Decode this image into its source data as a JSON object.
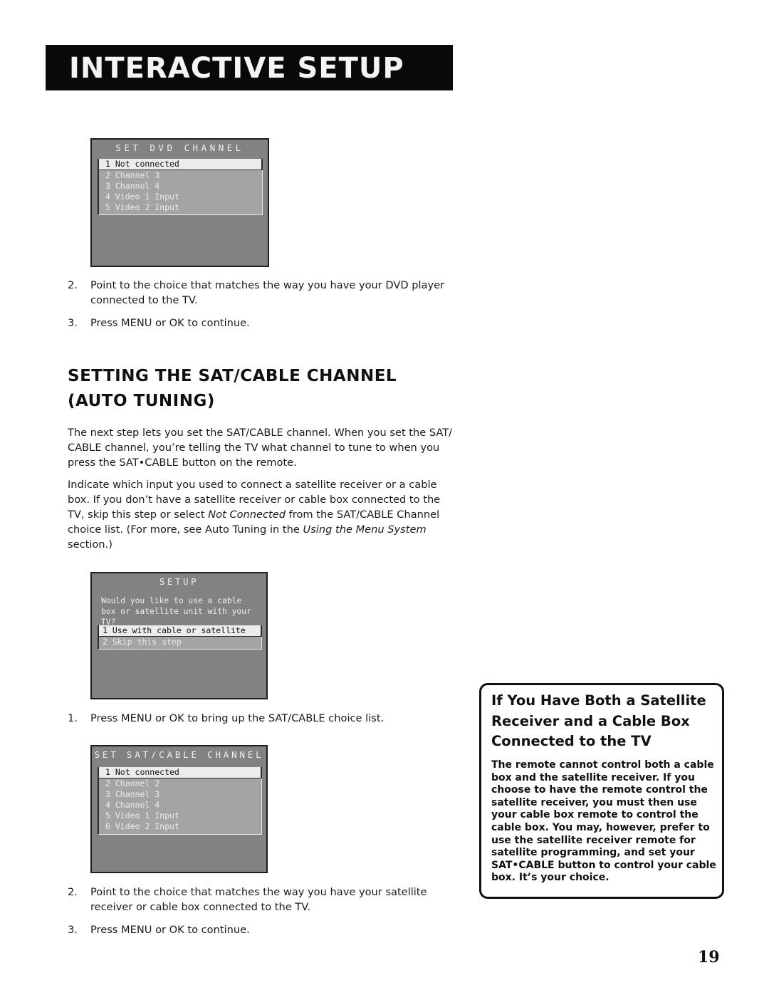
{
  "header": {
    "title": "Interactive Setup"
  },
  "dvd_menu": {
    "title": "SET DVD CHANNEL",
    "items": [
      "1 Not connected",
      "2 Channel 3",
      "3 Channel 4",
      "4 Video 1 Input",
      "5 Video 2 Input"
    ],
    "selected_index": 0
  },
  "dvd_steps": [
    {
      "num": "2.",
      "text": "Point to the choice that matches the way you have your DVD player connected to the TV."
    },
    {
      "num": "3.",
      "text": "Press MENU or OK to continue."
    }
  ],
  "section": {
    "title_line1": "Setting the SAT/CABLE Channel",
    "title_line2": "(Auto Tuning)",
    "para1": "The next step lets you set the SAT/CABLE channel. When you set the SAT/ CABLE channel, you’re telling the TV what channel to tune to when you press the SAT•CABLE button on the remote.",
    "para2_a": "Indicate which input you used to connect a satellite receiver or a cable box. If you don’t have a satellite receiver or cable box connected to the TV, skip this step or select ",
    "para2_b": "Not Connected",
    "para2_c": " from the SAT/CABLE Channel choice list. (For more, see Auto Tuning in the ",
    "para2_d": "Using the Menu System",
    "para2_e": " section.)"
  },
  "setup_menu": {
    "title": "SETUP",
    "prompt": "Would you like to use a cable\nbox or satellite unit with your\nTV?",
    "items": [
      "1 Use with cable or satellite",
      "2 Skip this step"
    ],
    "selected_index": 0
  },
  "setup_step": {
    "num": "1.",
    "text": "Press MENU or OK to bring up the SAT/CABLE choice list."
  },
  "satcable_menu": {
    "title": "SET SAT/CABLE CHANNEL",
    "items": [
      "1 Not connected",
      "2 Channel 2",
      "3 Channel 3",
      "4 Channel 4",
      "5 Video 1 Input",
      "6 Video 2 Input"
    ],
    "selected_index": 0
  },
  "satcable_steps": [
    {
      "num": "2.",
      "text": "Point to the choice that matches the way you have your satellite receiver or cable box connected to the TV."
    },
    {
      "num": "3.",
      "text": "Press MENU or OK to continue."
    }
  ],
  "sidebar": {
    "title": "If You Have Both a Satellite Receiver and a Cable Box Connected to the TV",
    "body": "The remote cannot control both a cable box and the satellite receiver. If you choose to have the remote control the satellite receiver, you must then use your cable box remote to control the cable box. You may, however, prefer to use the satellite receiver remote for satellite programming, and set your SAT•CABLE button to control your cable box. It’s your choice."
  },
  "page_number": "19"
}
